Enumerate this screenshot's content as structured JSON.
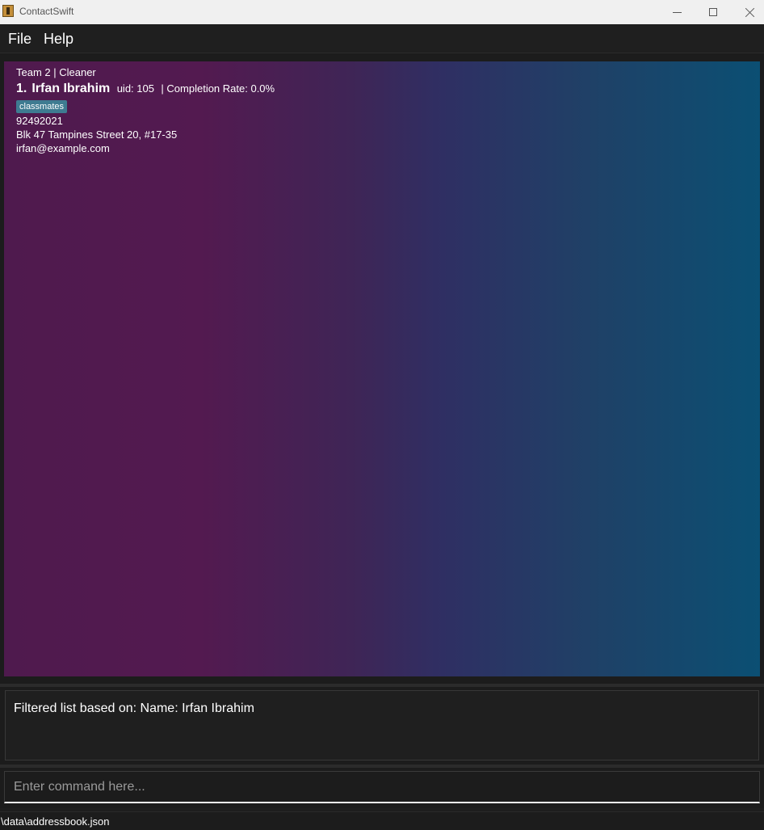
{
  "window": {
    "title": "ContactSwift",
    "icon": "app-icon"
  },
  "menu": {
    "items": [
      {
        "label": "File"
      },
      {
        "label": "Help"
      }
    ]
  },
  "person_list": {
    "cards": [
      {
        "header": "Team 2 | Cleaner",
        "index": "1.",
        "name": "Irfan Ibrahim",
        "uid": "uid: 105",
        "completion_rate": "| Completion Rate: 0.0%",
        "tags": [
          "classmates"
        ],
        "phone": "92492021",
        "address": "Blk 47 Tampines Street 20, #17-35",
        "email": "irfan@example.com"
      }
    ]
  },
  "result_display": {
    "text": "Filtered list based on: Name: Irfan Ibrahim"
  },
  "command_box": {
    "value": "",
    "placeholder": "Enter command here..."
  },
  "status_bar": {
    "path": "\\data\\addressbook.json"
  },
  "colors": {
    "tag_background": "#3e7b91",
    "gradient_start": "#4f1a4e",
    "gradient_end": "#0b4f73",
    "app_background": "#1c1c1c"
  }
}
